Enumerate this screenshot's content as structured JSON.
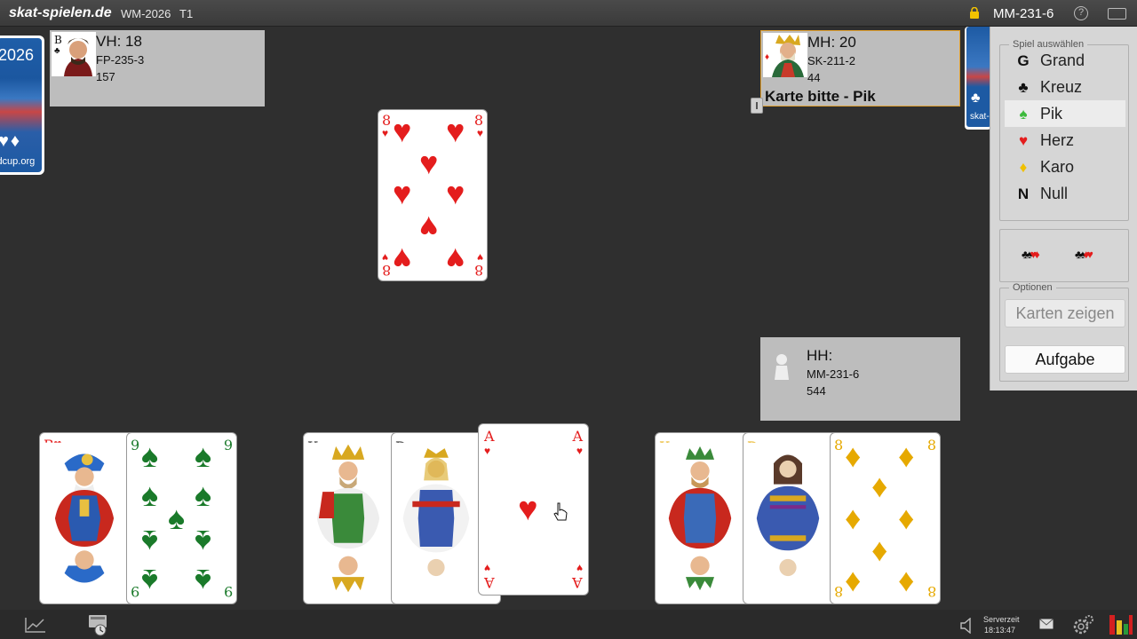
{
  "topbar": {
    "brand": "skat-spielen.de",
    "tournament": "WM-2026",
    "table": "T1",
    "user": "MM-231-6",
    "help_label": "?"
  },
  "deco_left": {
    "year": "2026",
    "suits": "♥♦",
    "site": "ldcup.org"
  },
  "deco_right": {
    "text": "skat-"
  },
  "players": {
    "vh": {
      "name": "VH: 18",
      "code": "FP-235-3",
      "score": "157",
      "avatar_letter": "B"
    },
    "mh": {
      "name": "MH: 20",
      "code": "SK-211-2",
      "score": "44",
      "message": "Karte bitte - Pik"
    },
    "hh": {
      "name": "HH:",
      "code": "MM-231-6",
      "score": "544"
    }
  },
  "trick": [
    {
      "rank": "8",
      "suit": "♥",
      "color": "red"
    }
  ],
  "hand": [
    {
      "rank": "B",
      "suit": "♥",
      "color": "red",
      "type": "face",
      "desc": "Herz Bube"
    },
    {
      "rank": "9",
      "suit": "♠",
      "color": "green",
      "type": "pips",
      "desc": "Pik Neun"
    },
    {
      "rank": "K",
      "suit": "♣",
      "color": "black",
      "type": "face",
      "desc": "Kreuz König"
    },
    {
      "rank": "D",
      "suit": "♣",
      "color": "black",
      "type": "face",
      "desc": "Kreuz Dame"
    },
    {
      "rank": "A",
      "suit": "♥",
      "color": "red",
      "type": "ace",
      "desc": "Herz Ass"
    },
    {
      "rank": "K",
      "suit": "♦",
      "color": "gold",
      "type": "face",
      "desc": "Karo König"
    },
    {
      "rank": "D",
      "suit": "♦",
      "color": "gold",
      "type": "face",
      "desc": "Karo Dame"
    },
    {
      "rank": "8",
      "suit": "♦",
      "color": "gold",
      "type": "pips",
      "desc": "Karo Acht"
    }
  ],
  "panel": {
    "game_select_label": "Spiel auswählen",
    "games": [
      {
        "icon": "G",
        "label": "Grand",
        "selected": false,
        "icon_color": "#111111"
      },
      {
        "icon": "♣",
        "label": "Kreuz",
        "selected": false,
        "icon_color": "#111111"
      },
      {
        "icon": "♠",
        "label": "Pik",
        "selected": true,
        "icon_color": "#3cba3c"
      },
      {
        "icon": "♥",
        "label": "Herz",
        "selected": false,
        "icon_color": "#e41d1d"
      },
      {
        "icon": "♦",
        "label": "Karo",
        "selected": false,
        "icon_color": "#f0c000"
      },
      {
        "icon": "N",
        "label": "Null",
        "selected": false,
        "icon_color": "#111111"
      }
    ],
    "sort_icons": [
      "♣♠♥♦",
      "♣♠♦♥"
    ],
    "options_label": "Optionen",
    "show_cards_label": "Karten zeigen",
    "give_up_label": "Aufgabe"
  },
  "bottombar": {
    "server_label": "Serverzeit",
    "server_time": "18:13:47"
  },
  "colors": {
    "background": "#2f2f2f",
    "panel": "#d6d6d6",
    "player_box": "#bdbdbd",
    "active_border": "#e0a030"
  }
}
